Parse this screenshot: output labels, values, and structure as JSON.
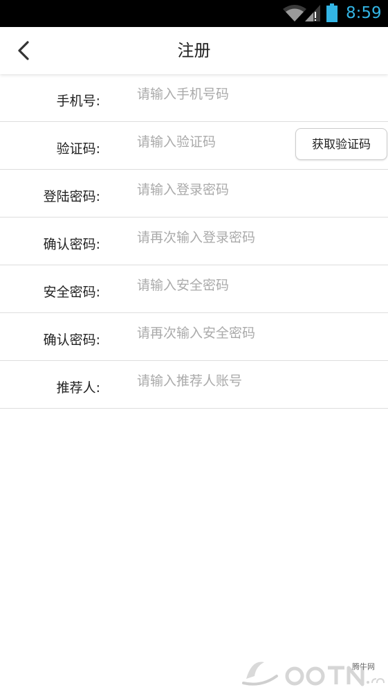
{
  "status_bar": {
    "time": "8:59",
    "wifi_icon": "wifi-icon",
    "signal_icon": "signal-icon",
    "battery_icon": "battery-icon",
    "accent_color": "#33b5e5"
  },
  "header": {
    "title": "注册",
    "back_icon": "chevron-left-icon"
  },
  "form": {
    "phone": {
      "label": "手机号:",
      "placeholder": "请输入手机号码",
      "value": ""
    },
    "code": {
      "label": "验证码:",
      "placeholder": "请输入验证码",
      "value": "",
      "button_label": "获取验证码"
    },
    "login_password": {
      "label": "登陆密码:",
      "placeholder": "请输入登录密码",
      "value": ""
    },
    "confirm_login_password": {
      "label": "确认密码:",
      "placeholder": "请再次输入登录密码",
      "value": ""
    },
    "security_password": {
      "label": "安全密码:",
      "placeholder": "请输入安全密码",
      "value": ""
    },
    "confirm_security_password": {
      "label": "确认密码:",
      "placeholder": "请再次输入安全密码",
      "value": ""
    },
    "referrer": {
      "label": "推荐人:",
      "placeholder": "请输入推荐人账号",
      "value": ""
    }
  },
  "watermark": {
    "text": "腾牛网",
    "logo_icon": "qqtn-logo-icon"
  }
}
